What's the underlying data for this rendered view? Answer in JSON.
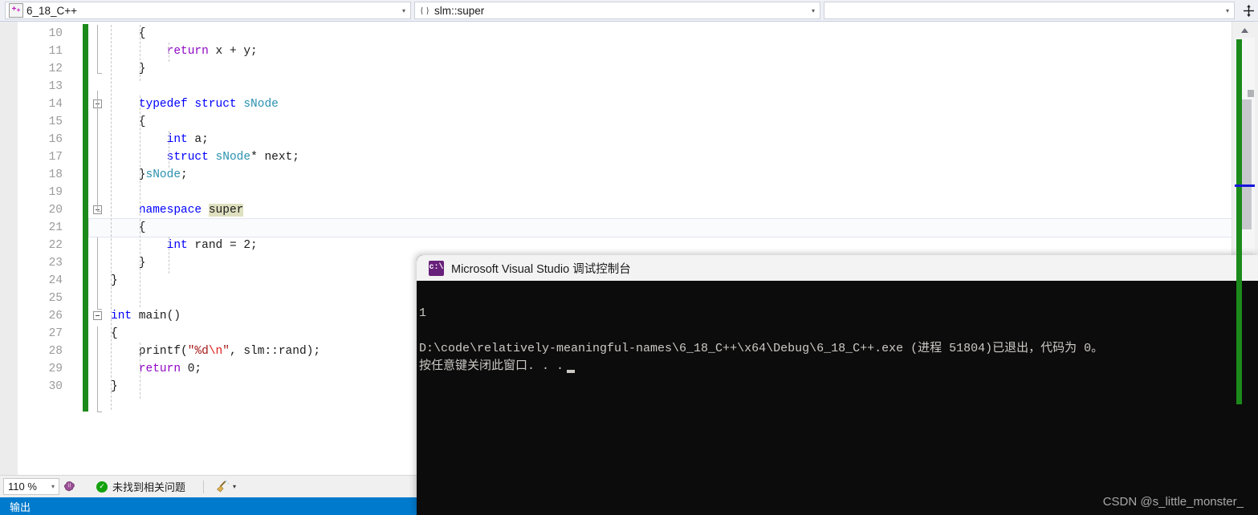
{
  "navbar": {
    "file_combo": {
      "icon": "cpp-file-icon",
      "value": "6_18_C++",
      "arrow": "▾"
    },
    "scope_combo": {
      "icon": "namespace-braces-icon",
      "value": "slm::super",
      "brace": "{ }",
      "arrow": "▾"
    },
    "member_combo": {
      "value": "",
      "arrow": "▾"
    },
    "splitview_label": "split-view"
  },
  "editor": {
    "lines": [
      {
        "num": "10",
        "tokens": [
          {
            "t": "    {",
            "c": "pln"
          }
        ]
      },
      {
        "num": "11",
        "tokens": [
          {
            "t": "        ",
            "c": "pln"
          },
          {
            "t": "return",
            "c": "kw-ctrl"
          },
          {
            "t": " x + y;",
            "c": "pln"
          }
        ]
      },
      {
        "num": "12",
        "tokens": [
          {
            "t": "    }",
            "c": "pln"
          }
        ]
      },
      {
        "num": "13",
        "tokens": []
      },
      {
        "num": "14",
        "tokens": [
          {
            "t": "    ",
            "c": "pln"
          },
          {
            "t": "typedef struct",
            "c": "kw"
          },
          {
            "t": " ",
            "c": "pln"
          },
          {
            "t": "sNode",
            "c": "typ"
          }
        ]
      },
      {
        "num": "15",
        "tokens": [
          {
            "t": "    {",
            "c": "pln"
          }
        ]
      },
      {
        "num": "16",
        "tokens": [
          {
            "t": "        ",
            "c": "pln"
          },
          {
            "t": "int",
            "c": "kw"
          },
          {
            "t": " a;",
            "c": "pln"
          }
        ]
      },
      {
        "num": "17",
        "tokens": [
          {
            "t": "        ",
            "c": "pln"
          },
          {
            "t": "struct",
            "c": "kw"
          },
          {
            "t": " ",
            "c": "pln"
          },
          {
            "t": "sNode",
            "c": "typ"
          },
          {
            "t": "* next;",
            "c": "pln"
          }
        ]
      },
      {
        "num": "18",
        "tokens": [
          {
            "t": "    }",
            "c": "pln"
          },
          {
            "t": "sNode",
            "c": "typ"
          },
          {
            "t": ";",
            "c": "pln"
          }
        ]
      },
      {
        "num": "19",
        "tokens": []
      },
      {
        "num": "20",
        "tokens": [
          {
            "t": "    ",
            "c": "pln"
          },
          {
            "t": "namespace",
            "c": "kw"
          },
          {
            "t": " ",
            "c": "pln"
          },
          {
            "t": "super",
            "c": "pln hl-super"
          }
        ]
      },
      {
        "num": "21",
        "tokens": [
          {
            "t": "    {",
            "c": "pln"
          }
        ]
      },
      {
        "num": "22",
        "tokens": [
          {
            "t": "        ",
            "c": "pln"
          },
          {
            "t": "int",
            "c": "kw"
          },
          {
            "t": " rand = 2;",
            "c": "pln"
          }
        ]
      },
      {
        "num": "23",
        "tokens": [
          {
            "t": "    }",
            "c": "pln"
          }
        ]
      },
      {
        "num": "24",
        "tokens": [
          {
            "t": "}",
            "c": "pln"
          }
        ]
      },
      {
        "num": "25",
        "tokens": []
      },
      {
        "num": "26",
        "tokens": [
          {
            "t": "int",
            "c": "kw"
          },
          {
            "t": " main()",
            "c": "pln"
          }
        ]
      },
      {
        "num": "27",
        "tokens": [
          {
            "t": "{",
            "c": "pln"
          }
        ]
      },
      {
        "num": "28",
        "tokens": [
          {
            "t": "    printf(",
            "c": "pln"
          },
          {
            "t": "\"%d",
            "c": "str"
          },
          {
            "t": "\\n",
            "c": "esc"
          },
          {
            "t": "\"",
            "c": "str"
          },
          {
            "t": ", slm::rand);",
            "c": "pln"
          }
        ]
      },
      {
        "num": "29",
        "tokens": [
          {
            "t": "    ",
            "c": "pln"
          },
          {
            "t": "return",
            "c": "kw-ctrl"
          },
          {
            "t": " 0;",
            "c": "pln"
          }
        ]
      },
      {
        "num": "30",
        "tokens": [
          {
            "t": "}",
            "c": "pln"
          }
        ]
      }
    ],
    "current_line_number": "20",
    "fold_markers": [
      "14",
      "20",
      "26"
    ],
    "change_bar_color": "#1b8a1b",
    "highlight_color": "#dfe0c0"
  },
  "statusbar": {
    "zoom_value": "110 %",
    "zoom_arrow": "▾",
    "intellisense_icon": "intellisense-brain-icon",
    "error_check_icon": "green-check-icon",
    "error_check_text": "未找到相关问题",
    "broom_icon": "code-cleanup-broom-icon",
    "broom_arrow": "▾"
  },
  "output_panel": {
    "tab_label": "输出",
    "accent": "#007acc"
  },
  "console": {
    "app_icon": "cmd-console-icon",
    "icon_glyph": "c:\\",
    "title": "Microsoft Visual Studio 调试控制台",
    "lines": [
      "1",
      "",
      "D:\\code\\relatively-meaningful-names\\6_18_C++\\x64\\Debug\\6_18_C++.exe (进程 51804)已退出，代码为 0。",
      "按任意键关闭此窗口. . ."
    ],
    "background": "#0c0c0c",
    "text_color": "#ccc9c4"
  },
  "watermark": {
    "text": "CSDN @s_little_monster_"
  }
}
